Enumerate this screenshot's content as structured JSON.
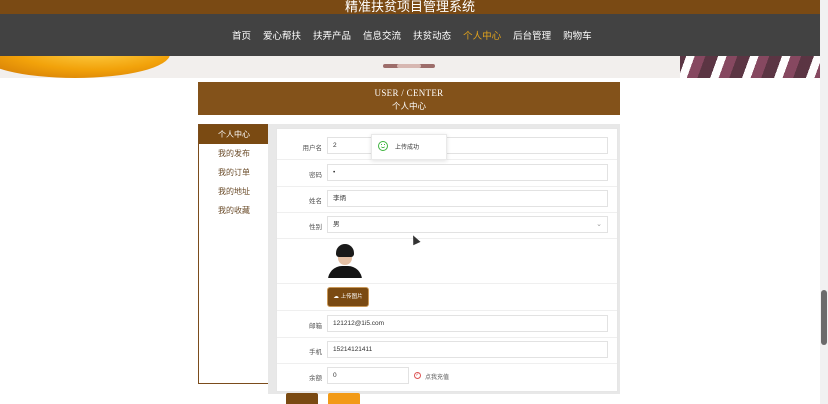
{
  "site": {
    "title": "精准扶贫项目管理系统"
  },
  "nav": {
    "items": [
      "首页",
      "爱心帮扶",
      "扶弄产品",
      "信息交流",
      "扶贫动态",
      "个人中心",
      "后台管理",
      "购物车"
    ],
    "active_index": 5
  },
  "center_header": {
    "en": "USER / CENTER",
    "cn": "个人中心"
  },
  "sidebar": {
    "items": [
      "个人中心",
      "我的发布",
      "我的订单",
      "我的地址",
      "我的收藏"
    ],
    "active_index": 0
  },
  "form": {
    "username": {
      "label": "用户名",
      "value": "2"
    },
    "password": {
      "label": "密码",
      "value": "•"
    },
    "name": {
      "label": "姓名",
      "value": "李炳"
    },
    "gender": {
      "label": "性别",
      "value": "男"
    },
    "upload_button": "上传图片",
    "email": {
      "label": "邮箱",
      "value": "121212@1i5.com"
    },
    "phone": {
      "label": "手机",
      "value": "15214121411"
    },
    "balance": {
      "label": "余额",
      "value": "0"
    },
    "recharge_link": "点我充值"
  },
  "toast": {
    "message": "上传成功"
  },
  "colors": {
    "brand_brown": "#7a4a12",
    "accent_gold": "#e3a41c",
    "navbar_gray": "#424242",
    "orange": "#f29a17"
  }
}
